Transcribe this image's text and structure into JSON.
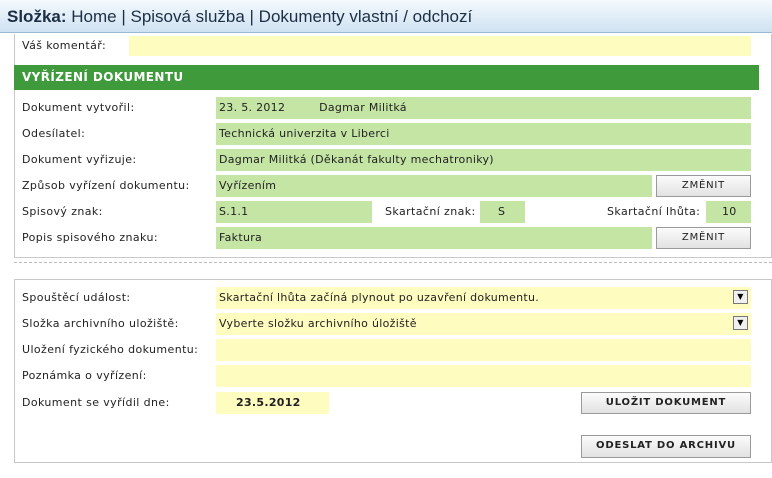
{
  "breadcrumb": {
    "label": "Složka:",
    "path": "Home | Spisová služba | Dokumenty vlastní / odchozí"
  },
  "comment": {
    "label": "Váš komentář:",
    "value": ""
  },
  "section": {
    "title": "VYŘÍZENÍ DOKUMENTU"
  },
  "fields": {
    "created_by_label": "Dokument vytvořil:",
    "created_date": "23. 5. 2012",
    "created_name": "Dagmar Militká",
    "sender_label": "Odesílatel:",
    "sender_value": "Technická univerzita v Liberci",
    "handler_label": "Dokument vyřizuje:",
    "handler_value": "Dagmar Militká (Děkanát fakulty mechatroniky)",
    "method_label": "Způsob vyřízení dokumentu:",
    "method_value": "Vyřízením",
    "change_button": "ZMĚNIT",
    "file_mark_label": "Spisový znak:",
    "file_mark_value": "S.1.1",
    "shred_mark_label": "Skartační znak:",
    "shred_mark_value": "S",
    "shred_period_label": "Skartační lhůta:",
    "shred_period_value": "10",
    "desc_label": "Popis spisového znaku:",
    "desc_value": "Faktura"
  },
  "archive": {
    "trigger_label": "Spouštěcí událost:",
    "trigger_value": "Skartační lhůta začíná plynout po uzavření dokumentu.",
    "folder_label": "Složka archivního uložiště:",
    "folder_value": "Vyberte složku archivního úložiště",
    "physical_label": "Uložení fyzického dokumentu:",
    "physical_value": "",
    "note_label": "Poznámka o vyřízení:",
    "note_value": "",
    "resolved_label": "Dokument se vyřídil dne:",
    "resolved_value": "23.5.2012",
    "save_button": "ULOŽIT DOKUMENT",
    "send_button": "ODESLAT DO ARCHIVU"
  }
}
